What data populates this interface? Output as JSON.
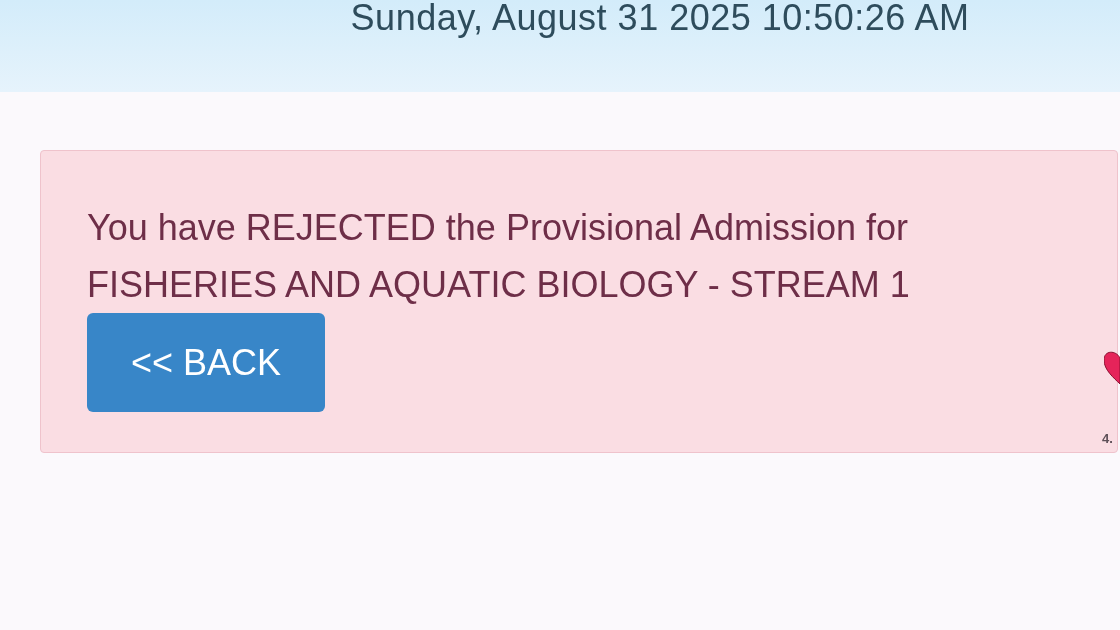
{
  "header": {
    "datetime": "Sunday, August 31 2025 10:50:26 AM"
  },
  "alert": {
    "message_lines": [
      "You have REJECTED the Provisional Admission for",
      "FISHERIES AND AQUATIC BIOLOGY - STREAM 1"
    ],
    "back_button": {
      "label": "<< BACK"
    }
  },
  "side_reaction": {
    "count": "4."
  }
}
